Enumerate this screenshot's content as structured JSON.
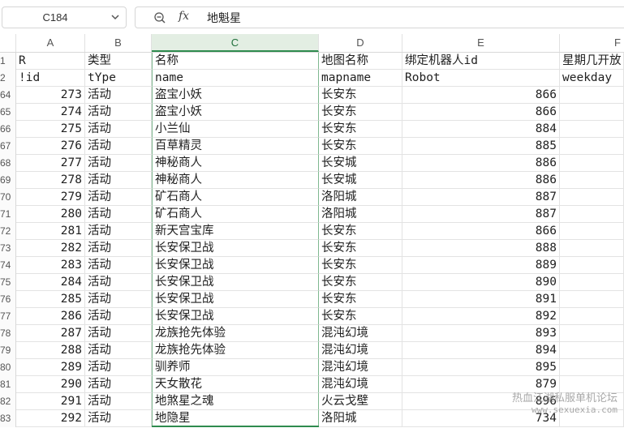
{
  "name_box": {
    "value": "C184"
  },
  "formula_bar": {
    "fx_label": "fx",
    "value": "地魁星"
  },
  "columns": [
    "A",
    "B",
    "C",
    "D",
    "E",
    "F"
  ],
  "selected_column": "C",
  "header_rows": [
    {
      "rownum": "1",
      "A": "R",
      "B": "类型",
      "C": "名称",
      "D": "地图名称",
      "E": "绑定机器人id",
      "F": "星期几开放"
    },
    {
      "rownum": "2",
      "A": "!id",
      "B": "tYpe",
      "C": "name",
      "D": "mapname",
      "E": "Robot",
      "F": "weekday"
    }
  ],
  "rows": [
    {
      "rownum": "64",
      "A": "273",
      "B": "活动",
      "C": "盗宝小妖",
      "D": "长安东",
      "E": "866"
    },
    {
      "rownum": "65",
      "A": "274",
      "B": "活动",
      "C": "盗宝小妖",
      "D": "长安东",
      "E": "866"
    },
    {
      "rownum": "66",
      "A": "275",
      "B": "活动",
      "C": "小兰仙",
      "D": "长安东",
      "E": "884"
    },
    {
      "rownum": "67",
      "A": "276",
      "B": "活动",
      "C": "百草精灵",
      "D": "长安东",
      "E": "885"
    },
    {
      "rownum": "68",
      "A": "277",
      "B": "活动",
      "C": "神秘商人",
      "D": "长安城",
      "E": "886"
    },
    {
      "rownum": "69",
      "A": "278",
      "B": "活动",
      "C": "神秘商人",
      "D": "长安城",
      "E": "886"
    },
    {
      "rownum": "70",
      "A": "279",
      "B": "活动",
      "C": "矿石商人",
      "D": "洛阳城",
      "E": "887"
    },
    {
      "rownum": "71",
      "A": "280",
      "B": "活动",
      "C": "矿石商人",
      "D": "洛阳城",
      "E": "887"
    },
    {
      "rownum": "72",
      "A": "281",
      "B": "活动",
      "C": "新天宫宝库",
      "D": "长安东",
      "E": "866"
    },
    {
      "rownum": "73",
      "A": "282",
      "B": "活动",
      "C": "长安保卫战",
      "D": "长安东",
      "E": "888"
    },
    {
      "rownum": "74",
      "A": "283",
      "B": "活动",
      "C": "长安保卫战",
      "D": "长安东",
      "E": "889"
    },
    {
      "rownum": "75",
      "A": "284",
      "B": "活动",
      "C": "长安保卫战",
      "D": "长安东",
      "E": "890"
    },
    {
      "rownum": "76",
      "A": "285",
      "B": "活动",
      "C": "长安保卫战",
      "D": "长安东",
      "E": "891"
    },
    {
      "rownum": "77",
      "A": "286",
      "B": "活动",
      "C": "长安保卫战",
      "D": "长安东",
      "E": "892"
    },
    {
      "rownum": "78",
      "A": "287",
      "B": "活动",
      "C": "龙族抢先体验",
      "D": "混沌幻境",
      "E": "893"
    },
    {
      "rownum": "79",
      "A": "288",
      "B": "活动",
      "C": "龙族抢先体验",
      "D": "混沌幻境",
      "E": "894"
    },
    {
      "rownum": "80",
      "A": "289",
      "B": "活动",
      "C": "驯养师",
      "D": "混沌幻境",
      "E": "895"
    },
    {
      "rownum": "81",
      "A": "290",
      "B": "活动",
      "C": "天女散花",
      "D": "混沌幻境",
      "E": "879"
    },
    {
      "rownum": "82",
      "A": "291",
      "B": "活动",
      "C": "地煞星之魂",
      "D": "火云戈壁",
      "E": "896"
    },
    {
      "rownum": "83",
      "A": "292",
      "B": "活动",
      "C": "地隐星",
      "D": "洛阳城",
      "E": "734"
    }
  ],
  "watermark": {
    "line1": "热血江湖私服单机论坛",
    "line2": "www.sexuexia.com"
  }
}
